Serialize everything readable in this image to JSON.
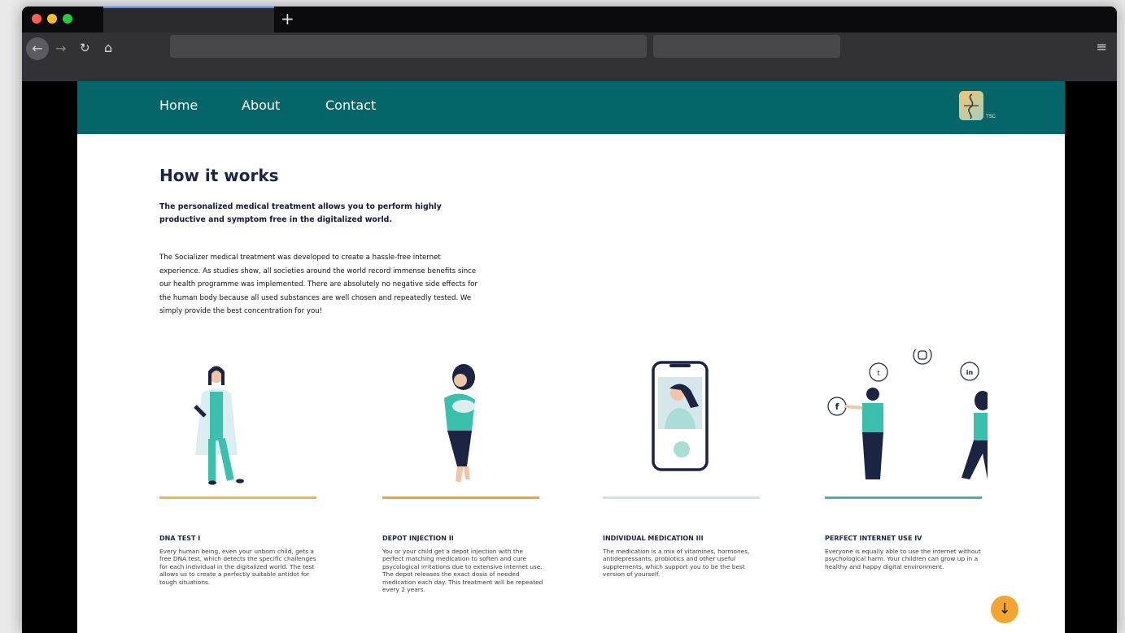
{
  "browser": {
    "new_tab_label": "+",
    "back_icon": "←",
    "forward_icon": "→",
    "reload_icon": "↻",
    "home_icon": "⌂",
    "menu_icon": "≡"
  },
  "site": {
    "nav": [
      {
        "label": "Home"
      },
      {
        "label": "About"
      },
      {
        "label": "Contact"
      }
    ],
    "logo_sub": "TSC"
  },
  "main": {
    "title": "How it works",
    "lead": "The personalized medical treatment allows you to perform highly productive and symptom free in the digitalized world.",
    "body": "The Socializer medical treatment was developed to create a hassle-free internet experience. As studies show, all societies around the world record immense benefits since our health programme was implemented. There are absolutely no negative side effects for the human body because all used substances are well chosen and repeatedly tested. We simply provide the best concentration for you!"
  },
  "cards": [
    {
      "title": "DNA TEST I",
      "text": "Every human being, even your unborn child, gets a free DNA test, which detects the specific challenges for each individual in the digitalized world. The test allows us to create a perfectly suitable antidot for tough situations.",
      "color": "#f5b14a"
    },
    {
      "title": "DEPOT INJECTION II",
      "text": "You or your child get a depot injection with the perfect matching medication to soften and cure psycological irritations due to extensive internet use. The depot releases the exact dosis of needed medication each day. This treatment will be repeated every 2 years.",
      "color": "#f3a23a"
    },
    {
      "title": "INDIVIDUAL MEDICATION III",
      "text": "The medication is a mix of vitamines, hormones, antidepressants, probiotics and other useful supplements, which support you to be the best version of yourself.",
      "color": "#cfe2e6"
    },
    {
      "title": "PERFECT INTERNET USE IV",
      "text": "Everyone is equally able to use the internet without psychological harm. Your children can grow up in a healthy and happy digital environment.",
      "color": "#3cb5b0"
    }
  ],
  "scroll_button_icon": "↓",
  "colors": {
    "header": "#05666a",
    "accent_orange": "#f4a431",
    "teal": "#3cc0ae",
    "navy": "#1c2443"
  }
}
